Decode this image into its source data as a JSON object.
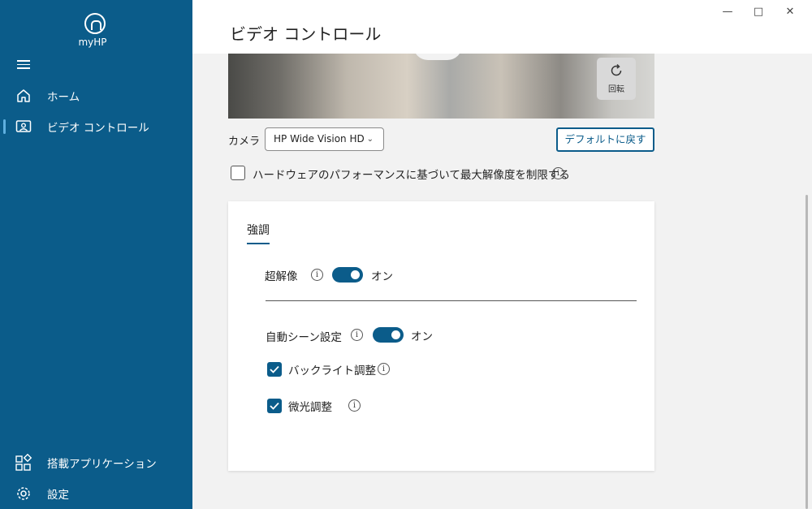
{
  "sidebar": {
    "app_name": "myHP",
    "nav": [
      {
        "label": "ホーム",
        "icon": "home-icon"
      },
      {
        "label": "ビデオ コントロール",
        "icon": "video-control-icon",
        "active": true
      }
    ],
    "bottom_nav": [
      {
        "label": "搭載アプリケーション",
        "icon": "apps-icon"
      },
      {
        "label": "設定",
        "icon": "gear-icon"
      }
    ]
  },
  "header": {
    "title": "ビデオ コントロール"
  },
  "preview": {
    "rotate_label": "回転"
  },
  "camera": {
    "label": "カメラ",
    "selected": "HP Wide Vision HD",
    "default_button": "デフォルトに戻す"
  },
  "hardware_limit": {
    "label": "ハードウェアのパフォーマンスに基づいて最大解像度を制限する",
    "checked": false
  },
  "enhance": {
    "tab_label": "強調",
    "super_res": {
      "label": "超解像",
      "state": "オン",
      "on": true
    },
    "auto_scene": {
      "label": "自動シーン設定",
      "state": "オン",
      "on": true
    },
    "backlight": {
      "label": "バックライト調整",
      "checked": true
    },
    "lowlight": {
      "label": "微光調整",
      "checked": true
    }
  },
  "colors": {
    "brand": "#0b5c8a",
    "background": "#f2f2f2"
  }
}
